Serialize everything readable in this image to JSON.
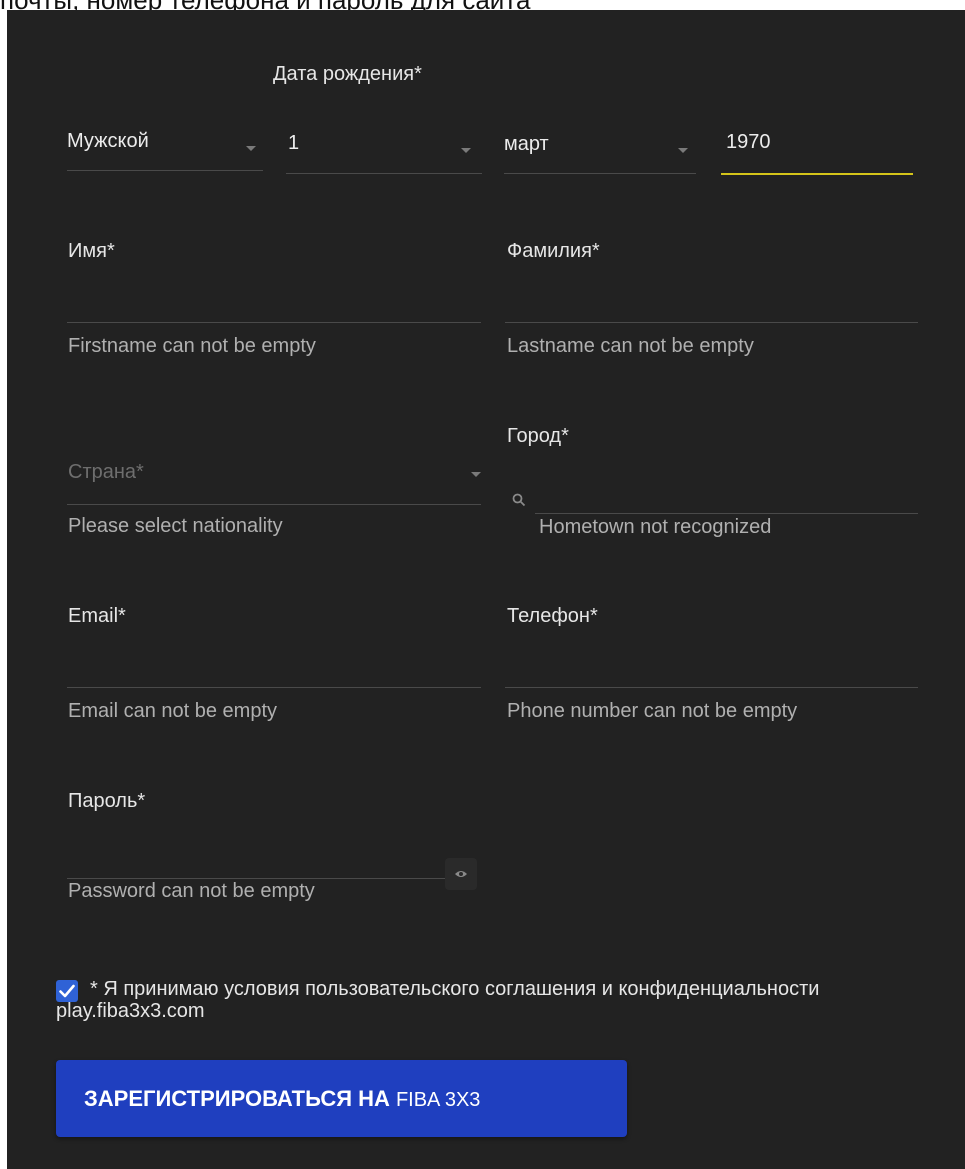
{
  "page": {
    "top_text": "почты, номер телефона и пароль для сайта"
  },
  "birth": {
    "label": "Дата рождения*"
  },
  "gender": {
    "value": "Мужской"
  },
  "day": {
    "value": "1"
  },
  "month": {
    "value": "март"
  },
  "year": {
    "value": "1970"
  },
  "first_name": {
    "label": "Имя*",
    "error": "Firstname can not be empty"
  },
  "last_name": {
    "label": "Фамилия*",
    "error": "Lastname can not be empty"
  },
  "country": {
    "placeholder": "Страна*",
    "error": "Please select nationality"
  },
  "city": {
    "label": "Город*",
    "error": "Hometown not recognized"
  },
  "email": {
    "label": "Email*",
    "error": "Email can not be empty"
  },
  "phone": {
    "label": "Телефон*",
    "error": "Phone number can not be empty"
  },
  "password": {
    "label": "Пароль*",
    "error": "Password can not be empty"
  },
  "terms": {
    "checked": true,
    "text": "* Я принимаю условия пользовательского соглашения и конфиденциальности play.fiba3x3.com"
  },
  "submit": {
    "label": "ЗАРЕГИСТРИРОВАТЬСЯ НА",
    "brand": "FIBA 3X3"
  },
  "icons": {
    "dropdown": "chevron-down-icon",
    "search": "search-icon",
    "eye": "eye-icon",
    "check": "check-icon"
  },
  "colors": {
    "background": "#222222",
    "active_underline": "#d4c41a",
    "button": "#1f3fbf",
    "checkbox": "#2f62d6"
  }
}
